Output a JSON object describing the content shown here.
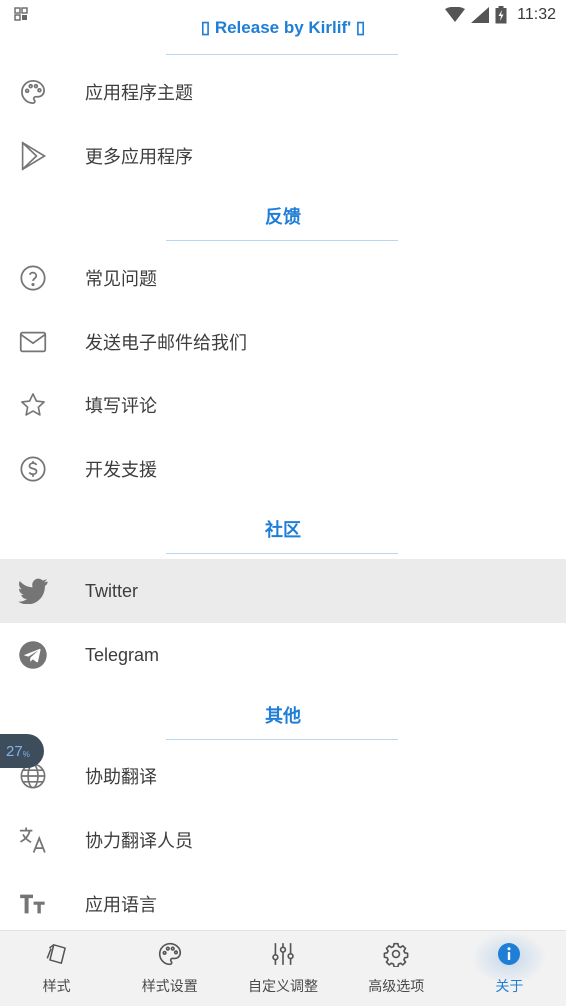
{
  "status_bar": {
    "time": "11:32"
  },
  "release_text": "▯ Release by Kirlif' ▯",
  "sections": {
    "feedback": "反馈",
    "community": "社区",
    "other": "其他"
  },
  "items": {
    "app_theme": "应用程序主题",
    "more_apps": "更多应用程序",
    "faq": "常见问题",
    "email": "发送电子邮件给我们",
    "review": "填写评论",
    "support": "开发支援",
    "twitter": "Twitter",
    "telegram": "Telegram",
    "help_translate": "协助翻译",
    "translators": "协力翻译人员",
    "app_language": "应用语言"
  },
  "badge": {
    "value": "27",
    "unit": "%"
  },
  "bottom_nav": {
    "style": "样式",
    "style_settings": "样式设置",
    "custom_adjust": "自定义调整",
    "advanced": "高级选项",
    "about": "关于"
  },
  "colors": {
    "accent": "#1f7ed6",
    "icon": "#757575",
    "highlight": "#ebebeb"
  }
}
